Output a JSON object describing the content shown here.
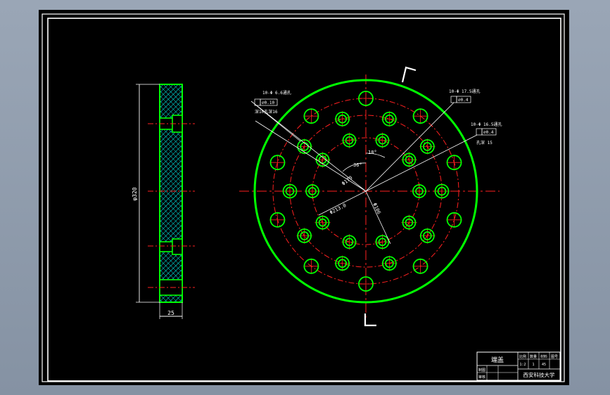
{
  "drawing": {
    "section_marker_top": "Γ",
    "section_marker_bottom": "L",
    "colors": {
      "outline": "#00ff00",
      "hatch": "#00ffff",
      "center": "#ff2020",
      "dims": "#ffffff",
      "note": "#ffffff"
    }
  },
  "side_view": {
    "height_dim": "φ320",
    "width_dim": "25"
  },
  "front_view": {
    "annotations": {
      "note_left_line1": "10-Φ 6.6通孔",
      "note_left_tol": "⌀0.10",
      "note_left_line2": "深10孔深16",
      "note_tr1_line1": "10-Φ 17.5通孔",
      "note_tr1_tol": "⌀0.4",
      "note_tr2_line1": "10-Φ 16.5通孔",
      "note_tr2_tol": "⌀0.4",
      "note_tr2_line2": "孔深 15",
      "angle_18": "18°",
      "angle_36": "36°",
      "dia_170": "Φ170",
      "dia_213": "Φ213.0",
      "dia_106": "Φ106"
    }
  },
  "title_block": {
    "part_name": "端盖",
    "header_cells": [
      "比例",
      "数量",
      "材料",
      "图号"
    ],
    "header_values": [
      "1:2",
      "1",
      "45",
      ""
    ],
    "row_labels": [
      "制图",
      "审核"
    ],
    "row_values": [
      "",
      ""
    ],
    "school": "西安科技大学"
  }
}
